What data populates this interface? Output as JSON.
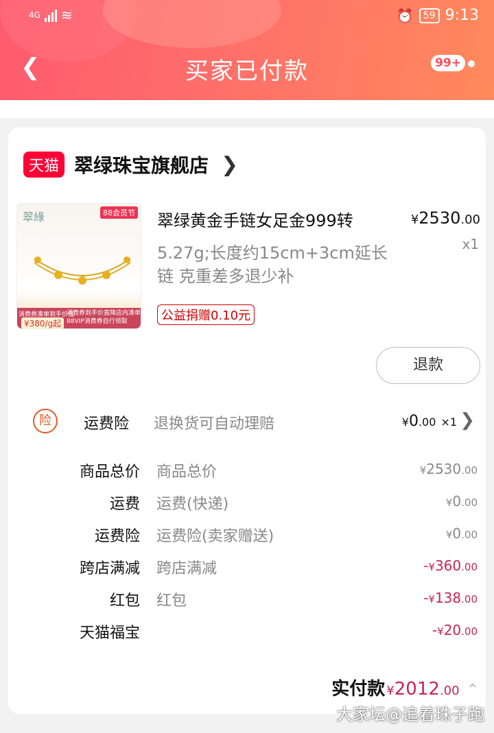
{
  "status_bar": {
    "network": "4G",
    "battery": "59",
    "time": "9:13"
  },
  "nav": {
    "title": "买家已付款",
    "badge": "99+"
  },
  "shop": {
    "platform": "天猫",
    "name": "翠绿珠宝旗舰店"
  },
  "product": {
    "name": "翠绿黄金手链女足金999转",
    "spec": "5.27g;长度约15cm+3cm延长链 克重差多退少补",
    "price_main": "2530",
    "price_cents": ".00",
    "currency": "¥",
    "qty": "x1",
    "charity": "公益捐赠0.10元",
    "image": {
      "logo": "翠綠",
      "tag": "88会员节",
      "promo1": "消费券凑单到手价低",
      "price_tag": "¥380/g起",
      "promo2": "消费券到手价直降店内凑单",
      "promo3": "88VIP消费券自行领取"
    }
  },
  "refund_label": "退款",
  "insurance": {
    "icon": "险",
    "label": "运费险",
    "desc": "退换货可自动理赔",
    "price_main": "0",
    "price_cents": ".00",
    "qty": "×1"
  },
  "breakdown": [
    {
      "label": "商品总价",
      "desc": "商品总价",
      "sign": "",
      "main": "2530",
      "cents": ".00",
      "red": false
    },
    {
      "label": "运费",
      "desc": "运费(快递)",
      "sign": "",
      "main": "0",
      "cents": ".00",
      "red": false
    },
    {
      "label": "运费险",
      "desc": "运费险(卖家赠送)",
      "sign": "",
      "main": "0",
      "cents": ".00",
      "red": false
    },
    {
      "label": "跨店满减",
      "desc": "跨店满减",
      "sign": "-",
      "main": "360",
      "cents": ".00",
      "red": true
    },
    {
      "label": "红包",
      "desc": "红包",
      "sign": "-",
      "main": "138",
      "cents": ".00",
      "red": true
    },
    {
      "label": "天猫福宝",
      "desc": "",
      "sign": "-",
      "main": "20",
      "cents": ".00",
      "red": true
    }
  ],
  "total": {
    "label": "实付款",
    "main": "2012",
    "cents": ".00"
  },
  "watermark": "大家坛@追着珠子跑",
  "colors": {
    "header_start": "#ff5a6e",
    "header_end": "#ff8a5c",
    "accent_red": "#c7254e",
    "tmall_red": "#ff0036"
  }
}
